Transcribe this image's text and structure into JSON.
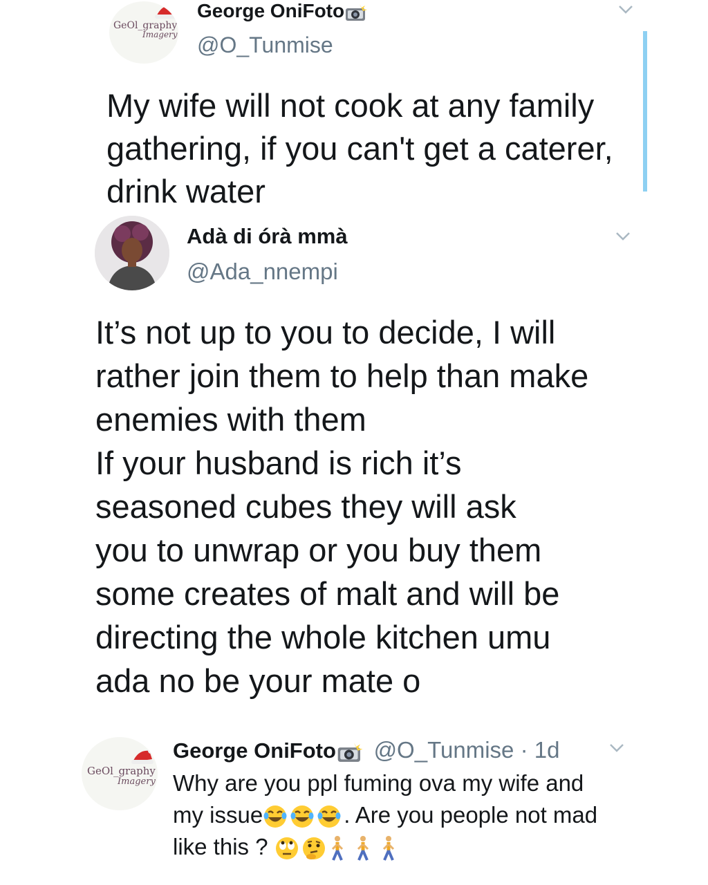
{
  "tweet1": {
    "logo_line1": "GeOl_graphy",
    "logo_line2": "Imagery",
    "name": "George OniFoto",
    "name_icon": "camera-flash-icon",
    "handle": "@O_Tunmise",
    "text": "My wife will not cook at any family\ngathering, if you can't get a caterer,\ndrink water"
  },
  "tweet2": {
    "avatar": "profile-photo-woman",
    "name": "Adà di órà mmà",
    "handle": "@Ada_nnempi",
    "text": "It’s not up to you to decide, I will\nrather join them to help than make\nenemies with them\nIf your husband is rich it’s\nseasoned cubes they will ask\nyou to unwrap or you buy them\nsome creates of malt and will be\ndirecting the whole kitchen umu\nada no be your mate o"
  },
  "tweet3": {
    "logo_line1": "GeOl_graphy",
    "logo_line2": "Imagery",
    "name": "George OniFoto",
    "name_icon": "camera-flash-icon",
    "handle_time": "@O_Tunmise · 1d",
    "text_line1": "Why are you ppl fuming ova my wife and",
    "text_line2a": "my issue",
    "text_line2b": ". Are you people not mad",
    "text_line3": "like this ?",
    "emojis_line2": [
      "tears-of-joy-emoji",
      "tears-of-joy-emoji",
      "tears-of-joy-emoji"
    ],
    "emojis_line3": [
      "eye-roll-emoji",
      "thinking-emoji",
      "walking-person-emoji",
      "walking-person-emoji",
      "walking-person-emoji"
    ]
  },
  "colors": {
    "text": "#14171a",
    "secondary": "#657786",
    "chevron": "#aab8c2",
    "thread_line": "#8ed0f2",
    "logo": "#6a4a5e",
    "santa_hat": "#d62b2b"
  }
}
